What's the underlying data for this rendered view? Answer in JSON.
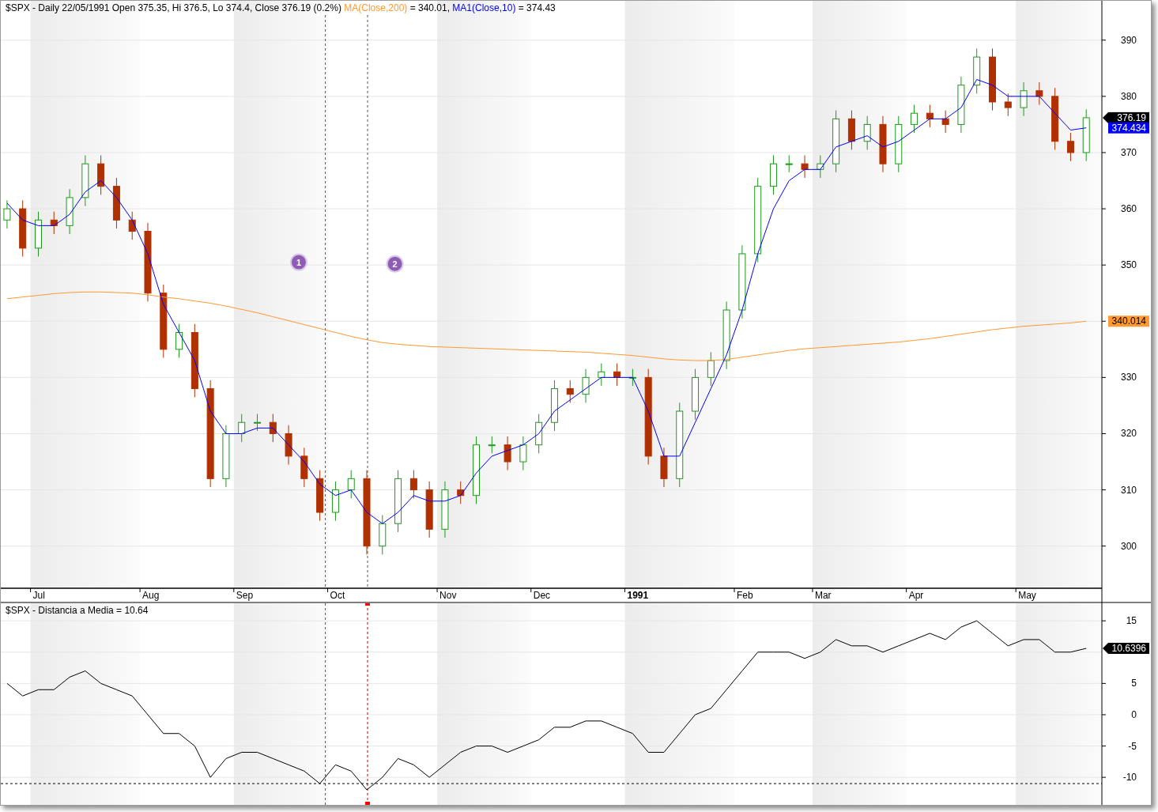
{
  "price_pane": {
    "title": "$SPX - Daily 22/05/1991 Open 375.35, Hi 376.5, Lo 374.4, Close 376.19 (0.2%) ",
    "legend_values": [
      " = 340.01, ",
      " = 374.43"
    ],
    "value_tags": [
      {
        "text": "376.19",
        "color": "#000000"
      },
      {
        "text": "374.434",
        "color": "#0000ff"
      },
      {
        "text": "340.014",
        "color": "#ff9933"
      }
    ],
    "candles": {
      "chart_data": {
        "type": "candlestick",
        "grid": true,
        "ohlc": [
          [
            358,
            361.5,
            356.5,
            360
          ],
          [
            360,
            361.5,
            351.5,
            353
          ],
          [
            353,
            359.5,
            351.5,
            358
          ],
          [
            358,
            359.5,
            355.5,
            357
          ],
          [
            357,
            363.5,
            355.5,
            362
          ],
          [
            362,
            369.5,
            360.5,
            368
          ],
          [
            368,
            369.5,
            362.5,
            364
          ],
          [
            364,
            365.5,
            356.5,
            358
          ],
          [
            358,
            359.5,
            354.5,
            356
          ],
          [
            356,
            357.5,
            343.5,
            345
          ],
          [
            345,
            346.5,
            333.5,
            335
          ],
          [
            335,
            339.5,
            333.5,
            338
          ],
          [
            338,
            339.5,
            326.5,
            328
          ],
          [
            328,
            329.5,
            310.5,
            312
          ],
          [
            312,
            321.5,
            310.5,
            320
          ],
          [
            320,
            323.5,
            318.5,
            322
          ],
          [
            322,
            323.5,
            320.5,
            322
          ],
          [
            322,
            323.5,
            318.5,
            320
          ],
          [
            320,
            321.5,
            314.5,
            316
          ],
          [
            316,
            317.5,
            310.5,
            312
          ],
          [
            312,
            313.5,
            304.5,
            306
          ],
          [
            306,
            311.5,
            304.5,
            310
          ],
          [
            310,
            313.5,
            308.5,
            312
          ],
          [
            312,
            313.5,
            298.5,
            300
          ],
          [
            300,
            305.5,
            298.5,
            304
          ],
          [
            304,
            313.5,
            302.5,
            312
          ],
          [
            312,
            313.5,
            308.5,
            310
          ],
          [
            310,
            311.5,
            301.5,
            303
          ],
          [
            303,
            311.5,
            301.5,
            310
          ],
          [
            310,
            311.5,
            307.5,
            309
          ],
          [
            309,
            319.5,
            307.5,
            318
          ],
          [
            318,
            319.5,
            316.5,
            318
          ],
          [
            318,
            319.5,
            313.5,
            315
          ],
          [
            315,
            319.5,
            313.5,
            318
          ],
          [
            318,
            323.5,
            316.5,
            322
          ],
          [
            322,
            329.5,
            320.5,
            328
          ],
          [
            328,
            329.5,
            325.5,
            327
          ],
          [
            327,
            331.5,
            325.5,
            330
          ],
          [
            330,
            332.5,
            328.5,
            331
          ],
          [
            331,
            332.5,
            328.5,
            330
          ],
          [
            330,
            331.5,
            328.5,
            330
          ],
          [
            330,
            331.5,
            314.5,
            316
          ],
          [
            316,
            317.5,
            310.5,
            312
          ],
          [
            312,
            325.5,
            310.5,
            324
          ],
          [
            324,
            331.5,
            322.5,
            330
          ],
          [
            330,
            334.5,
            328.5,
            333
          ],
          [
            333,
            343.5,
            331.5,
            342
          ],
          [
            342,
            353.5,
            340.5,
            352
          ],
          [
            352,
            365.5,
            350.5,
            364
          ],
          [
            364,
            369.5,
            362.5,
            368
          ],
          [
            368,
            369.5,
            366.5,
            368
          ],
          [
            368,
            369.5,
            365.5,
            367
          ],
          [
            367,
            369.5,
            365.5,
            368
          ],
          [
            368,
            377.5,
            366.5,
            376
          ],
          [
            376,
            377.5,
            370.5,
            372
          ],
          [
            372,
            376.5,
            370.5,
            375
          ],
          [
            375,
            376.5,
            366.5,
            368
          ],
          [
            368,
            376.5,
            366.5,
            375
          ],
          [
            375,
            378.5,
            373.5,
            377
          ],
          [
            377,
            378.5,
            374.5,
            376
          ],
          [
            376,
            377.5,
            373.5,
            375
          ],
          [
            375,
            383.5,
            373.5,
            382
          ],
          [
            382,
            388.5,
            380.5,
            387
          ],
          [
            387,
            388.5,
            377.5,
            379
          ],
          [
            379,
            380.5,
            376.5,
            378
          ],
          [
            378,
            382.5,
            376.5,
            381
          ],
          [
            381,
            382.5,
            378.5,
            380
          ],
          [
            380,
            381.5,
            370.5,
            372
          ],
          [
            372,
            373.5,
            368.5,
            370
          ],
          [
            370,
            377.7,
            368.5,
            376.2
          ]
        ],
        "ylim": [
          292.5,
          397
        ],
        "yticks": [
          300,
          310,
          320,
          330,
          350,
          360,
          370,
          380,
          390
        ],
        "annotations": [
          "1",
          "2"
        ]
      }
    },
    "averages": {
      "chart_data": {
        "type": "line",
        "categories": [
          null,
          null,
          "Jul",
          null,
          null,
          null,
          null,
          null,
          null,
          "Aug",
          null,
          null,
          null,
          null,
          null,
          "Sep",
          null,
          null,
          null,
          null,
          null,
          "Oct",
          null,
          null,
          null,
          null,
          null,
          null,
          "Nov",
          null,
          null,
          null,
          null,
          null,
          "Dec",
          null,
          null,
          null,
          null,
          null,
          "1991",
          null,
          null,
          null,
          null,
          null,
          null,
          "Feb",
          null,
          null,
          null,
          null,
          "Mar",
          null,
          null,
          null,
          null,
          null,
          "Apr",
          null,
          null,
          null,
          null,
          null,
          null,
          "May",
          null,
          null,
          null,
          null
        ],
        "series": [
          {
            "name": "MA(Close,200)",
            "color": "#ff9933",
            "values": [
              344,
              344.3,
              344.6,
              344.9,
              345.1,
              345.2,
              345.2,
              345.1,
              345,
              344.7,
              344.3,
              344,
              343.6,
              343.2,
              342.7,
              342.1,
              341.5,
              340.8,
              340.1,
              339.4,
              338.7,
              338,
              337.3,
              336.7,
              336.2,
              335.9,
              335.7,
              335.5,
              335.4,
              335.3,
              335.2,
              335.1,
              335,
              334.9,
              334.8,
              334.7,
              334.6,
              334.5,
              334.3,
              334.1,
              333.9,
              333.6,
              333.3,
              333.1,
              333,
              333,
              333.2,
              333.6,
              334,
              334.4,
              334.8,
              335.1,
              335.3,
              335.5,
              335.7,
              335.9,
              336.1,
              336.3,
              336.6,
              336.9,
              337.3,
              337.7,
              338.1,
              338.5,
              338.8,
              339.1,
              339.3,
              339.5,
              339.7,
              340
            ]
          },
          {
            "name": "MA1(Close,10)",
            "color": "#0000ff",
            "values": [
              361,
              358,
              357,
              357,
              359,
              363,
              365,
              362,
              358,
              352,
              343,
              338,
              333,
              324,
              320,
              320,
              321,
              321,
              318,
              315,
              311,
              309,
              310,
              306,
              304,
              306,
              309,
              308,
              308,
              309,
              313,
              316,
              317,
              318,
              320,
              324,
              326,
              328,
              330,
              330,
              330,
              324,
              316,
              316,
              322,
              328,
              334,
              342,
              352,
              360,
              365,
              367,
              367,
              371,
              372,
              373,
              371,
              372,
              374,
              376,
              376,
              378,
              383,
              382,
              380,
              380,
              380,
              377,
              374,
              374.4
            ]
          }
        ],
        "ylim": [
          292.5,
          397
        ]
      }
    }
  },
  "indicator_pane": {
    "value_tag": "10.6396",
    "chart_data": {
      "type": "line",
      "title": "$SPX - Distancia a Media = 10.64",
      "grid": true,
      "categories": [
        null,
        null,
        null,
        null,
        null,
        null,
        null,
        null,
        null,
        null,
        null,
        null,
        null,
        null,
        null,
        null,
        null,
        null,
        null,
        null,
        null,
        null,
        null,
        null,
        null,
        null,
        null,
        null,
        null,
        null,
        null,
        null,
        null,
        null,
        null,
        null,
        null,
        null,
        null,
        null,
        null,
        null,
        null,
        null,
        null,
        null,
        null,
        null,
        null,
        null,
        null,
        null,
        null,
        null,
        null,
        null,
        null,
        null,
        null,
        null,
        null,
        null,
        null,
        null,
        null,
        null,
        null,
        null,
        null,
        null
      ],
      "values": [
        5,
        3,
        4,
        4,
        6,
        7,
        5,
        4,
        3,
        0,
        -3,
        -3,
        -5,
        -10,
        -7,
        -6,
        -6,
        -7,
        -8,
        -9,
        -11,
        -8,
        -9,
        -12,
        -10,
        -7,
        -8,
        -10,
        -8,
        -6,
        -5,
        -5,
        -6,
        -5,
        -4,
        -2,
        -2,
        -1,
        -1,
        -2,
        -3,
        -6,
        -6,
        -3,
        0,
        1,
        4,
        7,
        10,
        10,
        10,
        9,
        10,
        12,
        11,
        11,
        10,
        11,
        12,
        13,
        12,
        14,
        15,
        13,
        11,
        12,
        12,
        10,
        10,
        10.6
      ],
      "ylim": [
        -14.4,
        17.8
      ],
      "yticks": [
        -10,
        -5,
        0,
        5,
        15
      ],
      "ref_lines": [
        {
          "axis": "y",
          "value": -11
        }
      ]
    }
  }
}
